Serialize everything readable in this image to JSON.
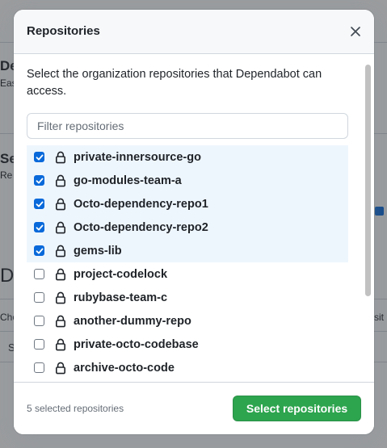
{
  "background": {
    "fragments": [
      "De",
      "Eas",
      "Se",
      "Re",
      "De",
      "Cho",
      "S",
      "sit"
    ]
  },
  "dialog": {
    "title": "Repositories",
    "close_icon": "close-icon",
    "description": "Select the organization repositories that Dependabot can access.",
    "filter": {
      "placeholder": "Filter repositories",
      "value": ""
    },
    "repositories": [
      {
        "name": "private-innersource-go",
        "checked": true
      },
      {
        "name": "go-modules-team-a",
        "checked": true
      },
      {
        "name": "Octo-dependency-repo1",
        "checked": true
      },
      {
        "name": "Octo-dependency-repo2",
        "checked": true
      },
      {
        "name": "gems-lib",
        "checked": true
      },
      {
        "name": "project-codelock",
        "checked": false
      },
      {
        "name": "rubybase-team-c",
        "checked": false
      },
      {
        "name": "another-dummy-repo",
        "checked": false
      },
      {
        "name": "private-octo-codebase",
        "checked": false
      },
      {
        "name": "archive-octo-code",
        "checked": false
      }
    ],
    "footer": {
      "selected_count": "5 selected repositories",
      "primary_button": "Select repositories"
    }
  },
  "colors": {
    "primary": "#2da44e",
    "accent": "#0969da",
    "selected_row": "#eef6fd"
  }
}
